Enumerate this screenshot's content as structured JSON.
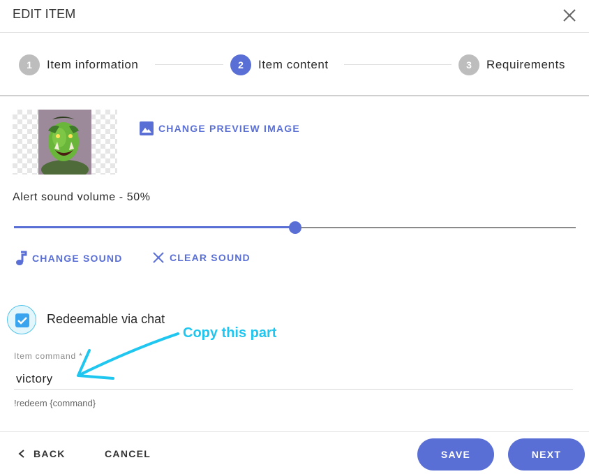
{
  "dialog": {
    "title": "EDIT ITEM"
  },
  "stepper": {
    "steps": [
      {
        "number": "1",
        "label": "Item information",
        "state": "inactive"
      },
      {
        "number": "2",
        "label": "Item content",
        "state": "active"
      },
      {
        "number": "3",
        "label": "Requirements",
        "state": "inactive"
      }
    ]
  },
  "content": {
    "change_preview_label": "CHANGE PREVIEW IMAGE",
    "volume_label": "Alert sound volume - 50%",
    "volume_value": 0.5,
    "change_sound_label": "CHANGE SOUND",
    "clear_sound_label": "CLEAR SOUND",
    "redeemable_label": "Redeemable via chat",
    "redeemable_checked": true,
    "annotation_text": "Copy this part",
    "command_label": "Item command *",
    "command_value": "victory",
    "command_hint": "!redeem {command}"
  },
  "footer": {
    "back_label": "BACK",
    "cancel_label": "CANCEL",
    "save_label": "SAVE",
    "next_label": "NEXT"
  },
  "colors": {
    "accent": "#5a6fd6",
    "annotation": "#1fc6ef",
    "checkbox": "#3aa4ee",
    "inactive_step": "#bdbdbd"
  }
}
